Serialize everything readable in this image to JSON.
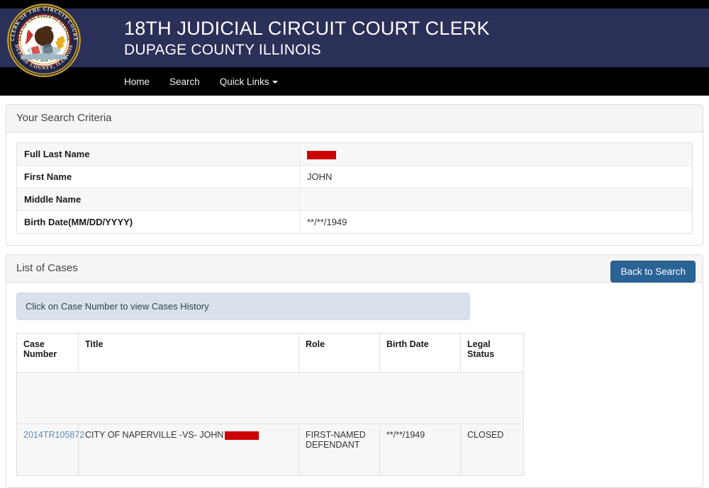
{
  "header": {
    "title": "18TH JUDICIAL CIRCUIT COURT CLERK",
    "subtitle": "DUPAGE COUNTY ILLINOIS",
    "seal": {
      "outer_top_text": "CLERK OF THE CIRCUIT COURT",
      "outer_bottom_text": "DUPAGE COUNTY, ILLINOIS",
      "inner_top_text": "SEAL OF THE STATE OF ILLINOIS",
      "inner_bottom_text": "AUG 26th 1818"
    },
    "nav": [
      {
        "label": "Home"
      },
      {
        "label": "Search"
      },
      {
        "label": "Quick Links"
      }
    ]
  },
  "search_criteria": {
    "panel_title": "Your Search Criteria",
    "rows": [
      {
        "label": "Full Last Name",
        "value": "",
        "redacted": true
      },
      {
        "label": "First Name",
        "value": "JOHN",
        "redacted": false
      },
      {
        "label": "Middle Name",
        "value": "",
        "redacted": false
      },
      {
        "label": "Birth Date(MM/DD/YYYY)",
        "value": "**/**/1949",
        "redacted": false
      }
    ]
  },
  "cases": {
    "panel_title": "List of Cases",
    "back_button_label": "Back to Search",
    "alert_text": "Click on Case Number to view Cases History",
    "columns": [
      "Case Number",
      "Title",
      "Role",
      "Birth Date",
      "Legal Status"
    ],
    "rows": [
      {
        "case_number": "2014TR105872",
        "title_prefix": "CITY OF NAPERVILLE -VS- JOHN",
        "title_redacted": true,
        "role": "FIRST-NAMED DEFENDANT",
        "birth_date": "**/**/1949",
        "legal_status": "CLOSED"
      }
    ]
  },
  "colors": {
    "banner": "#2b3058",
    "navbar": "#000000",
    "button": "#2a6496",
    "link": "#5b8db8",
    "redaction": "#cc0000",
    "alert": "#d9e2ec"
  }
}
